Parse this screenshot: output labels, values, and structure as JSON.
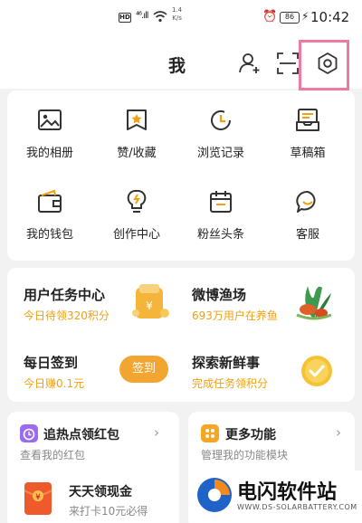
{
  "statusbar": {
    "hd": "HD",
    "signal": "⁴⁶.ıll",
    "speed_value": "1.4",
    "speed_unit": "K/s",
    "battery": "86",
    "time": "10:42"
  },
  "header": {
    "title": "我"
  },
  "grid": [
    {
      "label": "我的相册",
      "icon": "photo-album-icon"
    },
    {
      "label": "赞/收藏",
      "icon": "favorite-icon"
    },
    {
      "label": "浏览记录",
      "icon": "history-icon"
    },
    {
      "label": "草稿箱",
      "icon": "draft-box-icon"
    },
    {
      "label": "我的钱包",
      "icon": "wallet-icon"
    },
    {
      "label": "创作中心",
      "icon": "creator-bulb-icon"
    },
    {
      "label": "粉丝头条",
      "icon": "calendar-icon"
    },
    {
      "label": "客服",
      "icon": "customer-service-icon"
    }
  ],
  "tasks": [
    {
      "title": "用户任务中心",
      "sub": "今日待领320积分"
    },
    {
      "title": "微博渔场",
      "sub": "693万用户在养鱼"
    },
    {
      "title": "每日签到",
      "sub": "今日赚0.1元",
      "button": "签到"
    },
    {
      "title": "探索新鲜事",
      "sub": "完成任务领积分"
    }
  ],
  "bottom": {
    "hot_title": "追热点领红包",
    "hot_sub": "查看我的红包",
    "cash_title": "天天领现金",
    "cash_sub": "来打卡10元必得",
    "more_title": "更多功能",
    "more_sub": "管理我的功能模块"
  },
  "watermark": {
    "name": "电闪软件站",
    "url": "WWW.DS-SOLARBATTERY.COM"
  },
  "colors": {
    "accent": "#f0a010",
    "highlight": "#ee7aa3",
    "pill": "#f3a532"
  }
}
